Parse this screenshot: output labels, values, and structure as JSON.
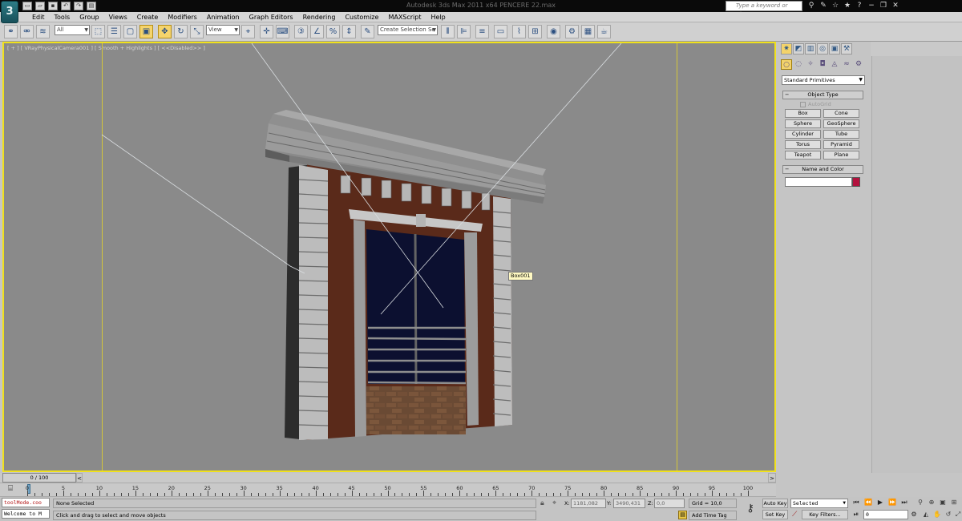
{
  "app": {
    "logo": "3",
    "title": "Autodesk 3ds Max  2011 x64     PENCERE 22.max",
    "search_placeholder": "Type a keyword or phrase"
  },
  "quick_access": [
    "new-icon",
    "open-icon",
    "save-icon",
    "undo-icon",
    "redo-icon",
    "project-icon"
  ],
  "menus": [
    "Edit",
    "Tools",
    "Group",
    "Views",
    "Create",
    "Modifiers",
    "Animation",
    "Graph Editors",
    "Rendering",
    "Customize",
    "MAXScript",
    "Help"
  ],
  "toolbar": {
    "filter_value": "All",
    "refcoord_value": "View",
    "selection_set_placeholder": "Create Selection Se"
  },
  "viewport": {
    "label": "[ + ] [ VRayPhysicalCamera001 ] [ Smooth + Highlights ] [ <<Disabled>> ]",
    "object_tag": "Box001"
  },
  "command_panel": {
    "category": "Standard Primitives",
    "object_type_title": "Object Type",
    "autogrid_label": "AutoGrid",
    "objects": [
      "Box",
      "Cone",
      "Sphere",
      "GeoSphere",
      "Cylinder",
      "Tube",
      "Torus",
      "Pyramid",
      "Teapot",
      "Plane"
    ],
    "name_color_title": "Name and Color",
    "name_value": "",
    "color": "#b3123e"
  },
  "timeline": {
    "frame_label": "0 / 100",
    "ticks": [
      "0",
      "5",
      "10",
      "15",
      "20",
      "25",
      "30",
      "35",
      "40",
      "45",
      "50",
      "55",
      "60",
      "65",
      "70",
      "75",
      "80",
      "85",
      "90",
      "95",
      "100"
    ]
  },
  "status": {
    "maxscript_line1": "toolMode.coo",
    "maxscript_line2": "Welcome to M",
    "selection": "None Selected",
    "prompt": "Click and drag to select and move objects",
    "x_label": "X:",
    "x_value": "1181,082",
    "y_label": "Y:",
    "y_value": "3490,431",
    "z_label": "Z:",
    "z_value": "0,0",
    "grid": "Grid = 10,0",
    "add_time_tag": "Add Time Tag",
    "auto_key": "Auto Key",
    "set_key": "Set Key",
    "selected_value": "Selected",
    "key_filters": "Key Filters...",
    "frame_value": "0"
  }
}
